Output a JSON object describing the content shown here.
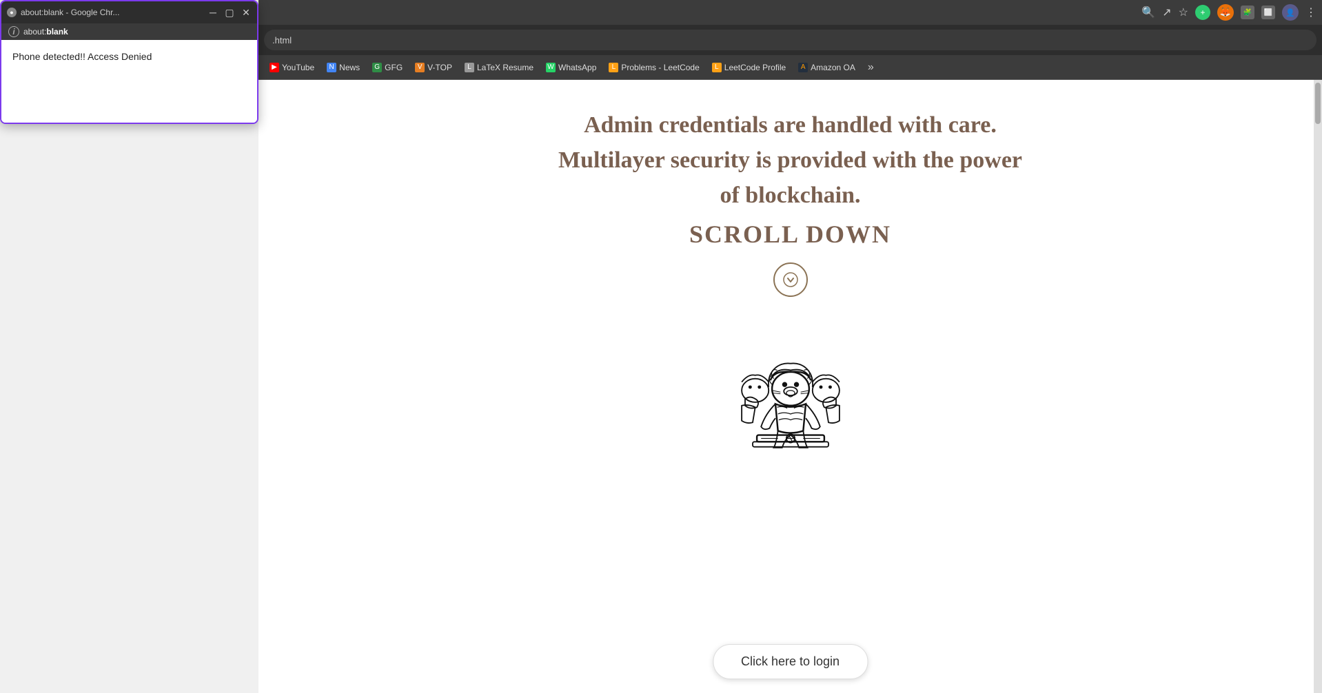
{
  "popup": {
    "title": "about:blank - Google Chr...",
    "address": "about:blank",
    "address_bold": "blank",
    "message": "Phone detected!! Access Denied"
  },
  "browser": {
    "address": ".html",
    "bookmarks": [
      {
        "label": "YouTube",
        "icon": "▶",
        "class": "bm-yt"
      },
      {
        "label": "News",
        "icon": "N",
        "class": "bm-news"
      },
      {
        "label": "GFG",
        "icon": "G",
        "class": "bm-gfg"
      },
      {
        "label": "V-TOP",
        "icon": "V",
        "class": "bm-vtop"
      },
      {
        "label": "LaTeX Resume",
        "icon": "L",
        "class": "bm-latex"
      },
      {
        "label": "WhatsApp",
        "icon": "W",
        "class": "bm-whatsapp"
      },
      {
        "label": "Problems - LeetCode",
        "icon": "L",
        "class": "bm-leetcode"
      },
      {
        "label": "LeetCode Profile",
        "icon": "L",
        "class": "bm-leetcode2"
      },
      {
        "label": "Amazon OA",
        "icon": "A",
        "class": "bm-amazon"
      }
    ],
    "more_label": "»"
  },
  "page": {
    "hero_line1": "Admin credentials are handled with care.",
    "hero_line2": "Multilayer security is provided with the power",
    "hero_line3": "of blockchain.",
    "scroll_text": "SCROLL DOWN",
    "login_button": "Click here to login"
  }
}
